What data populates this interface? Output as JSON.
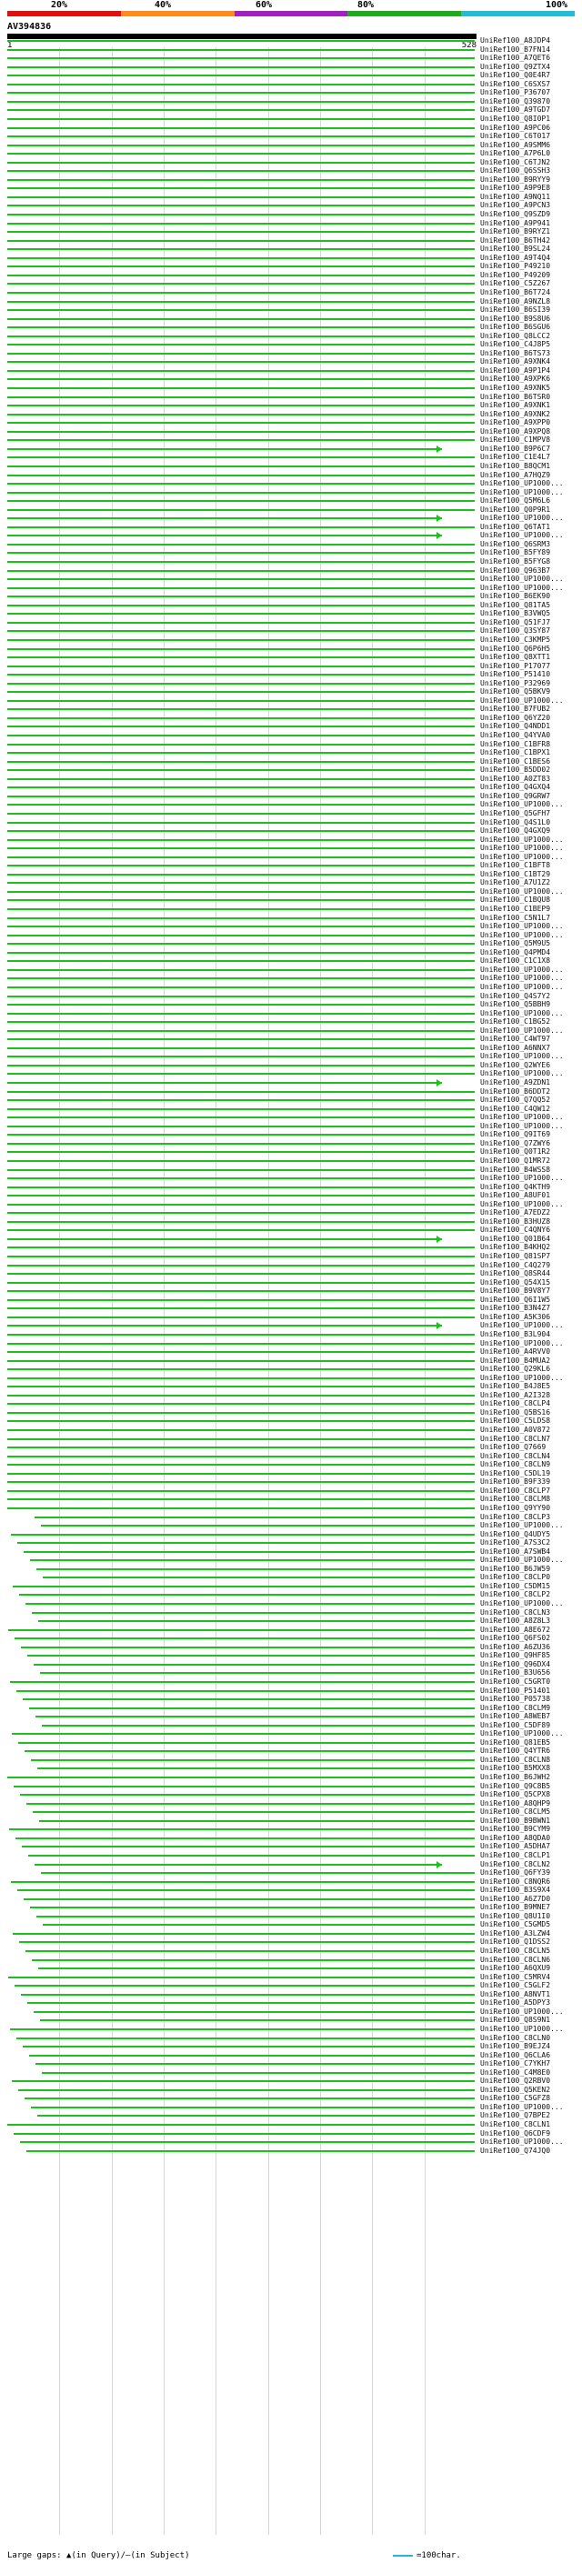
{
  "scale": {
    "ticks": [
      "20%",
      "40%",
      "60%",
      "80%",
      "100%"
    ],
    "colors": [
      "#e01010",
      "#ff8c1a",
      "#a020c0",
      "#1faa1f",
      "#22bcd8"
    ]
  },
  "query": {
    "id": "AV394836",
    "start": "1",
    "end": "528"
  },
  "footer": {
    "gap_text": "Large gaps: ▲(in Query)/—(in Subject)",
    "legend_text": "=100char."
  },
  "hits": [
    "UniRef100_A8JDP4",
    "UniRef100_B7FN14",
    "UniRef100_A7QET6",
    "UniRef100_Q9ZTX4",
    "UniRef100_Q0E4R7",
    "UniRef100_C6SXS7",
    "UniRef100_P36707",
    "UniRef100_Q39870",
    "UniRef100_A9TGD7",
    "UniRef100_Q8I0P1",
    "UniRef100_A9PC06",
    "UniRef100_C6T017",
    "UniRef100_A9SMM6",
    "UniRef100_A7P6L0",
    "UniRef100_C6TJN2",
    "UniRef100_Q6SSH3",
    "UniRef100_B9RYY9",
    "UniRef100_A9P9E8",
    "UniRef100_A9NQ11",
    "UniRef100_A9PCN3",
    "UniRef100_Q9SZD9",
    "UniRef100_A9P941",
    "UniRef100_B9RYZ1",
    "UniRef100_B6TH42",
    "UniRef100_B9SL24",
    "UniRef100_A9T4Q4",
    "UniRef100_P49210",
    "UniRef100_P49209",
    "UniRef100_C5Z267",
    "UniRef100_B6T724",
    "UniRef100_A9NZL8",
    "UniRef100_B6SI39",
    "UniRef100_B9S8U6",
    "UniRef100_B6SGU6",
    "UniRef100_Q8LCC2",
    "UniRef100_C4J8P5",
    "UniRef100_B6TS73",
    "UniRef100_A9XNK4",
    "UniRef100_A9P1P4",
    "UniRef100_A9XPK6",
    "UniRef100_A9XNK5",
    "UniRef100_B6TSR0",
    "UniRef100_A9XNK1",
    "UniRef100_A9XNK2",
    "UniRef100_A9XPP0",
    "UniRef100_A9XPQ8",
    "UniRef100_C1MPV8",
    "UniRef100_B9P6C7",
    "UniRef100_C1E4L7",
    "UniRef100_B8QCM1",
    "UniRef100_A7HQZ9",
    "UniRef100_UP1000...",
    "UniRef100_UP1000...",
    "UniRef100_Q5M6L6",
    "UniRef100_Q0P9R1",
    "UniRef100_UP1000...",
    "UniRef100_Q6TAT1",
    "UniRef100_UP1000...",
    "UniRef100_Q6SRM3",
    "UniRef100_B5FY89",
    "UniRef100_B5FYG8",
    "UniRef100_Q963B7",
    "UniRef100_UP1000...",
    "UniRef100_UP1000...",
    "UniRef100_B6EK90",
    "UniRef100_Q81TA5",
    "UniRef100_B3VWQ5",
    "UniRef100_Q51FJ7",
    "UniRef100_Q3SY87",
    "UniRef100_C3KMP5",
    "UniRef100_Q6P6H5",
    "UniRef100_Q8XTT1",
    "UniRef100_P17077",
    "UniRef100_P51410",
    "UniRef100_P32969",
    "UniRef100_Q5BKV9",
    "UniRef100_UP1000...",
    "UniRef100_B7FUB2",
    "UniRef100_Q6YZ20",
    "UniRef100_Q4NDD1",
    "UniRef100_Q4YVA0",
    "UniRef100_C1BFR8",
    "UniRef100_C1BPX1",
    "UniRef100_C1BES6",
    "UniRef100_B5DD02",
    "UniRef100_A0ZT83",
    "UniRef100_Q4GXQ4",
    "UniRef100_Q9GRW7",
    "UniRef100_UP1000...",
    "UniRef100_Q5GFH7",
    "UniRef100_Q4S1L0",
    "UniRef100_Q4GXQ9",
    "UniRef100_UP1000...",
    "UniRef100_UP1000...",
    "UniRef100_UP1000...",
    "UniRef100_C1BFT8",
    "UniRef100_C1BT29",
    "UniRef100_A7U1Z2",
    "UniRef100_UP1000...",
    "UniRef100_C1BQU8",
    "UniRef100_C1BEP9",
    "UniRef100_C5N1L7",
    "UniRef100_UP1000...",
    "UniRef100_UP1000...",
    "UniRef100_Q5M9U5",
    "UniRef100_Q4PMD4",
    "UniRef100_C1C1X8",
    "UniRef100_UP1000...",
    "UniRef100_UP1000...",
    "UniRef100_UP1000...",
    "UniRef100_Q4S7Y2",
    "UniRef100_Q5BBH9",
    "UniRef100_UP1000...",
    "UniRef100_C1BG52",
    "UniRef100_UP1000...",
    "UniRef100_C4WT97",
    "UniRef100_A6NNX7",
    "UniRef100_UP1000...",
    "UniRef100_Q2WYE6",
    "UniRef100_UP1000...",
    "UniRef100_A9ZDN1",
    "UniRef100_B6DDT2",
    "UniRef100_Q7QQ52",
    "UniRef100_C4QW12",
    "UniRef100_UP1000...",
    "UniRef100_UP1000...",
    "UniRef100_Q9IT69",
    "UniRef100_Q7ZWY6",
    "UniRef100_Q0T1R2",
    "UniRef100_Q1MR72",
    "UniRef100_B4WSS8",
    "UniRef100_UP1000...",
    "UniRef100_Q4KTH9",
    "UniRef100_A8UF01",
    "UniRef100_UP1000...",
    "UniRef100_A7EDZ2",
    "UniRef100_B3HUZ8",
    "UniRef100_C4QNY6",
    "UniRef100_Q01B64",
    "UniRef100_B4KHQ2",
    "UniRef100_Q81SP7",
    "UniRef100_C4Q279",
    "UniRef100_Q8SR44",
    "UniRef100_Q54X15",
    "UniRef100_B9V8Y7",
    "UniRef100_Q6I1W5",
    "UniRef100_B3N4Z7",
    "UniRef100_A5K306",
    "UniRef100_UP1000...",
    "UniRef100_B3L904",
    "UniRef100_UP1000...",
    "UniRef100_A4RVV0",
    "UniRef100_B4MUA2",
    "UniRef100_Q29KL6",
    "UniRef100_UP1000...",
    "UniRef100_B4J8E5",
    "UniRef100_A2I328",
    "UniRef100_C8CLP4",
    "UniRef100_Q5BS16",
    "UniRef100_C5LDS8",
    "UniRef100_A0V872",
    "UniRef100_C8CLN7",
    "UniRef100_Q7669",
    "UniRef100_C8CLN4",
    "UniRef100_C8CLN9",
    "UniRef100_C5DL19",
    "UniRef100_B9F339",
    "UniRef100_C8CLP7",
    "UniRef100_C8CLM8",
    "UniRef100_Q9YY90",
    "UniRef100_C8CLP3",
    "UniRef100_UP1000...",
    "UniRef100_Q4UDY5",
    "UniRef100_A7S3C2",
    "UniRef100_A7SWB4",
    "UniRef100_UP1000...",
    "UniRef100_B6JW59",
    "UniRef100_C8CLP0",
    "UniRef100_C5DM15",
    "UniRef100_C8CLP2",
    "UniRef100_UP1000...",
    "UniRef100_C8CLN3",
    "UniRef100_A8Z8L3",
    "UniRef100_A8E672",
    "UniRef100_Q6FS02",
    "UniRef100_A6ZU36",
    "UniRef100_Q9HF85",
    "UniRef100_Q96DX4",
    "UniRef100_B3U656",
    "UniRef100_C5GRT0",
    "UniRef100_P51401",
    "UniRef100_P05738",
    "UniRef100_C8CLM9",
    "UniRef100_A8WEB7",
    "UniRef100_C5DF89",
    "UniRef100_UP1000...",
    "UniRef100_Q81EB5",
    "UniRef100_Q4YTR6",
    "UniRef100_C8CLN8",
    "UniRef100_B5MXX8",
    "UniRef100_B6JWH2",
    "UniRef100_Q9C8B5",
    "UniRef100_Q5CPX8",
    "UniRef100_A8QHP9",
    "UniRef100_C8CLM5",
    "UniRef100_B9BWN1",
    "UniRef100_B9CYM9",
    "UniRef100_A8QDA0",
    "UniRef100_A5DHA7",
    "UniRef100_C8CLP1",
    "UniRef100_C8CLN2",
    "UniRef100_Q6FY39",
    "UniRef100_C8NQR6",
    "UniRef100_B3S9X4",
    "UniRef100_A6Z7D0",
    "UniRef100_B9MNE7",
    "UniRef100_Q8U1I0",
    "UniRef100_C5GMD5",
    "UniRef100_A3LZW4",
    "UniRef100_Q1DSS2",
    "UniRef100_C8CLN5",
    "UniRef100_C8CLN6",
    "UniRef100_A6QXU9",
    "UniRef100_C5MRV4",
    "UniRef100_C5GLF2",
    "UniRef100_A8NVT1",
    "UniRef100_A5DPY3",
    "UniRef100_UP1000...",
    "UniRef100_Q8S9N1",
    "UniRef100_UP1000...",
    "UniRef100_C8CLN0",
    "UniRef100_B9EJZ4",
    "UniRef100_Q6CLA6",
    "UniRef100_C7YKH7",
    "UniRef100_C4M8E0",
    "UniRef100_Q2RBV0",
    "UniRef100_Q5KEN2",
    "UniRef100_C5GFZ8",
    "UniRef100_UP1000...",
    "UniRef100_Q7BPE2",
    "UniRef100_C8CLN1",
    "UniRef100_Q6CDF9",
    "UniRef100_UP1000...",
    "UniRef100_Q74JQ0"
  ]
}
